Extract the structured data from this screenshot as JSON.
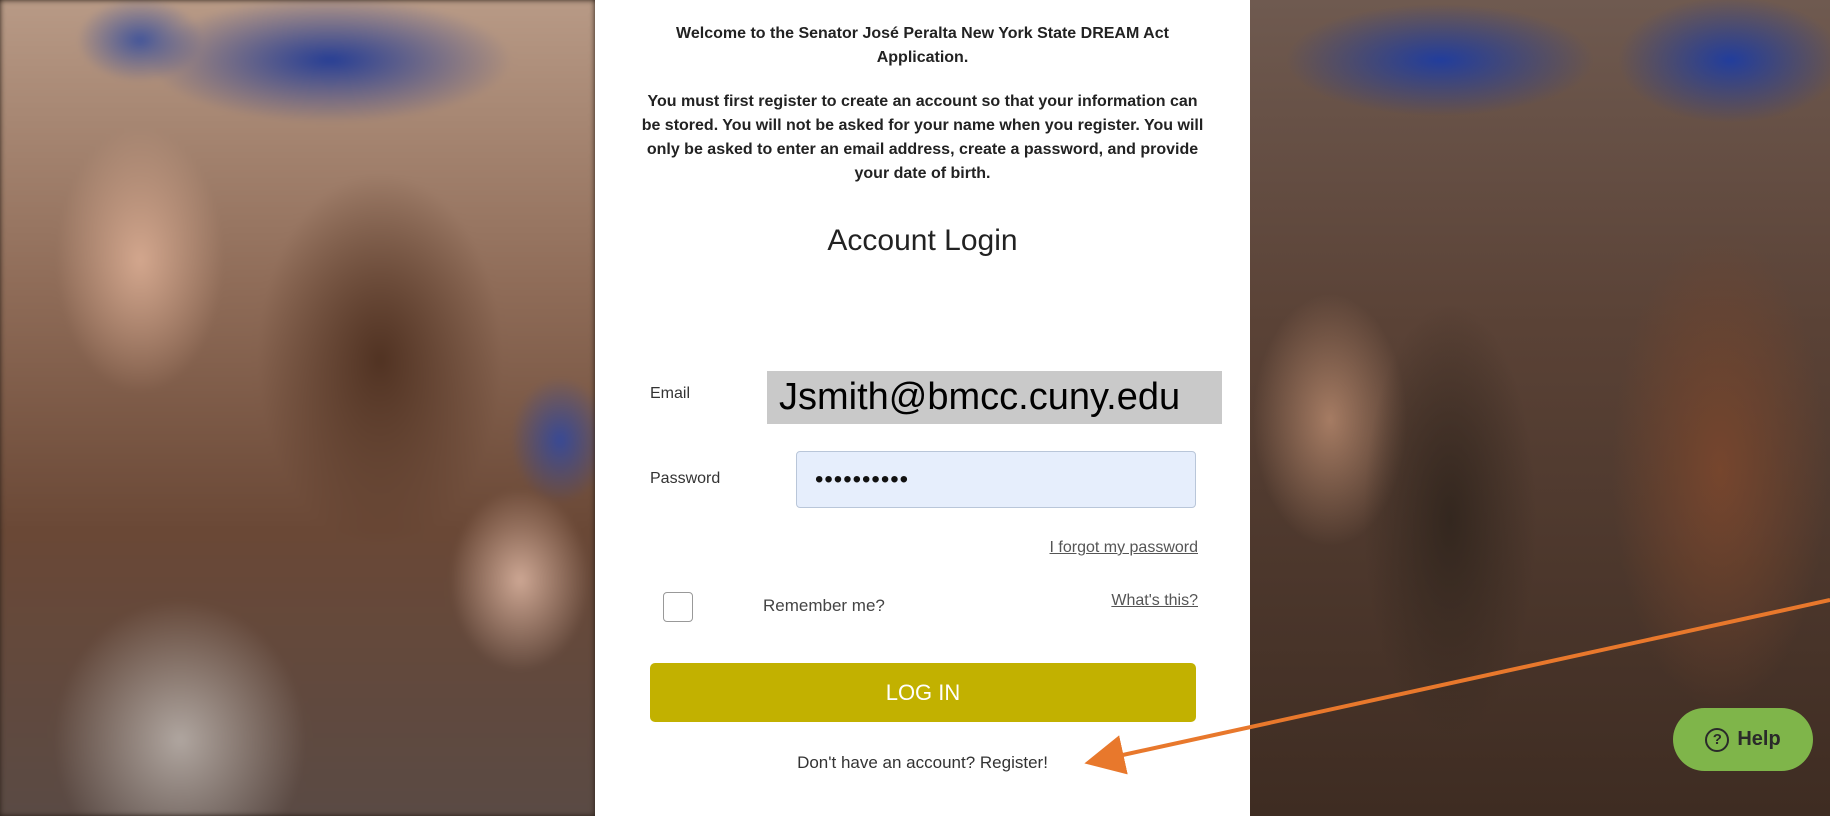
{
  "intro": {
    "welcome": "Welcome to the Senator José Peralta New York State DREAM Act Application.",
    "instructions": "You must first register to create an account so that your information can be stored. You will not be asked for your name when you register. You will only be asked to enter an email address, create a password, and provide your date of birth."
  },
  "login": {
    "title": "Account Login",
    "email_label": "Email",
    "email_value": "Jsmith@bmcc.cuny.edu",
    "password_label": "Password",
    "password_value": "••••••••••",
    "forgot_link": "I forgot my password",
    "remember_label": "Remember me?",
    "whats_this_link": "What's this?",
    "login_button": "LOG IN",
    "register_link": "Don't have an account? Register!"
  },
  "help": {
    "label": "Help",
    "icon": "question-circle-icon"
  },
  "colors": {
    "login_button": "#c2b100",
    "help_button": "#7fb54a",
    "arrow": "#e8782c"
  },
  "annotation": {
    "arrow_points_to": "register-link"
  }
}
